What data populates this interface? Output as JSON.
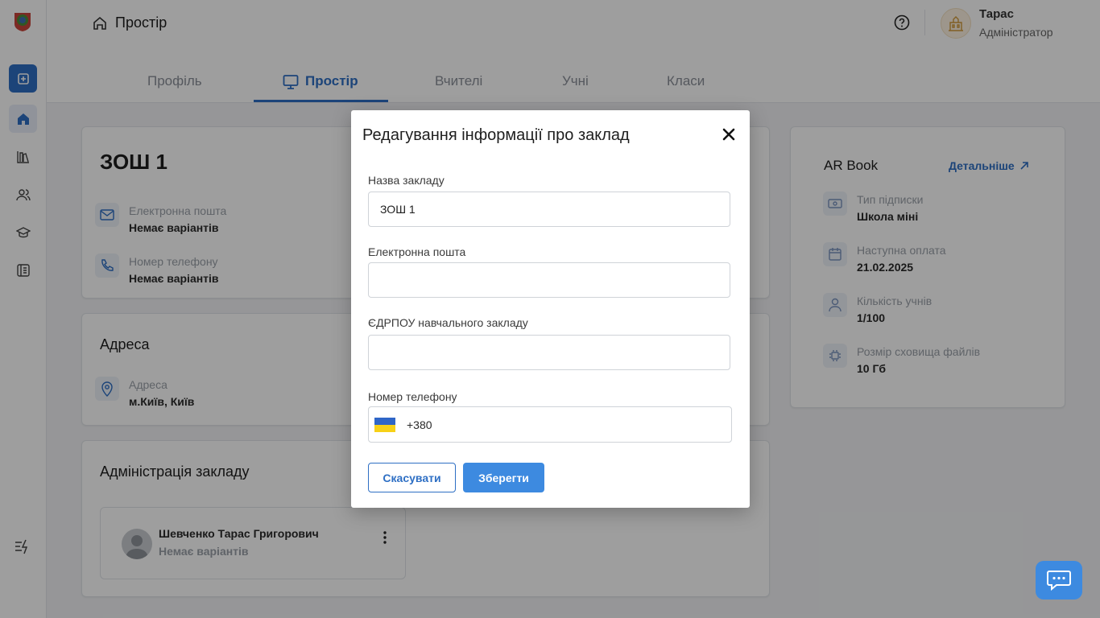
{
  "breadcrumb": {
    "title": "Простір"
  },
  "user": {
    "name": "Тарас",
    "role": "Адміністратор"
  },
  "tabs": [
    {
      "label": "Профіль"
    },
    {
      "label": "Простір"
    },
    {
      "label": "Вчителі"
    },
    {
      "label": "Учні"
    },
    {
      "label": "Класи"
    }
  ],
  "school_card": {
    "title": "ЗОШ 1",
    "email_label": "Електронна пошта",
    "email_value": "Немає варіантів",
    "phone_label": "Номер телефону",
    "phone_value": "Немає варіантів"
  },
  "address_card": {
    "title": "Адреса",
    "label": "Адреса",
    "value": "м.Київ, Київ"
  },
  "admin_card": {
    "title": "Адміністрація закладу",
    "name": "Шевченко Тарас Григорович",
    "sub": "Немає варіантів"
  },
  "ar_card": {
    "title": "AR Book",
    "link": "Детальніше",
    "rows": [
      {
        "label": "Тип підписки",
        "value": "Школа міні"
      },
      {
        "label": "Наступна оплата",
        "value": "21.02.2025"
      },
      {
        "label": "Кількість учнів",
        "value": "1/100"
      },
      {
        "label": "Розмір сховища файлів",
        "value": "10 Гб"
      }
    ]
  },
  "modal": {
    "title": "Редагування інформації про заклад",
    "name_label": "Назва закладу",
    "name_value": "ЗОШ 1",
    "email_label": "Електронна пошта",
    "email_value": "",
    "edrpou_label": "ЄДРПОУ навчального закладу",
    "edrpou_value": "",
    "phone_label": "Номер телефону",
    "phone_code": "+380",
    "cancel": "Скасувати",
    "save": "Зберегти"
  },
  "colors": {
    "accent": "#2e6fc4",
    "save_button": "#3d8ae0",
    "flag_blue": "#2f66c7",
    "flag_yellow": "#f7d117"
  }
}
